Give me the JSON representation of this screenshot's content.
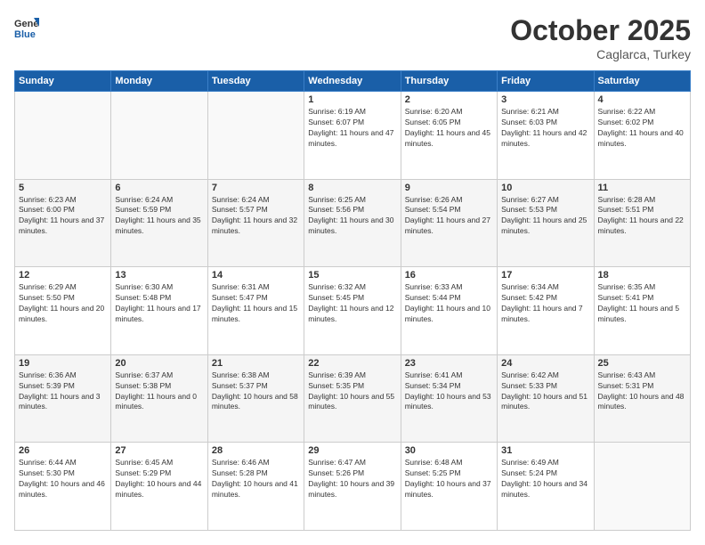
{
  "header": {
    "logo_line1": "General",
    "logo_line2": "Blue",
    "title": "October 2025",
    "subtitle": "Caglarca, Turkey"
  },
  "days_of_week": [
    "Sunday",
    "Monday",
    "Tuesday",
    "Wednesday",
    "Thursday",
    "Friday",
    "Saturday"
  ],
  "weeks": [
    [
      {
        "day": "",
        "info": ""
      },
      {
        "day": "",
        "info": ""
      },
      {
        "day": "",
        "info": ""
      },
      {
        "day": "1",
        "info": "Sunrise: 6:19 AM\nSunset: 6:07 PM\nDaylight: 11 hours and 47 minutes."
      },
      {
        "day": "2",
        "info": "Sunrise: 6:20 AM\nSunset: 6:05 PM\nDaylight: 11 hours and 45 minutes."
      },
      {
        "day": "3",
        "info": "Sunrise: 6:21 AM\nSunset: 6:03 PM\nDaylight: 11 hours and 42 minutes."
      },
      {
        "day": "4",
        "info": "Sunrise: 6:22 AM\nSunset: 6:02 PM\nDaylight: 11 hours and 40 minutes."
      }
    ],
    [
      {
        "day": "5",
        "info": "Sunrise: 6:23 AM\nSunset: 6:00 PM\nDaylight: 11 hours and 37 minutes."
      },
      {
        "day": "6",
        "info": "Sunrise: 6:24 AM\nSunset: 5:59 PM\nDaylight: 11 hours and 35 minutes."
      },
      {
        "day": "7",
        "info": "Sunrise: 6:24 AM\nSunset: 5:57 PM\nDaylight: 11 hours and 32 minutes."
      },
      {
        "day": "8",
        "info": "Sunrise: 6:25 AM\nSunset: 5:56 PM\nDaylight: 11 hours and 30 minutes."
      },
      {
        "day": "9",
        "info": "Sunrise: 6:26 AM\nSunset: 5:54 PM\nDaylight: 11 hours and 27 minutes."
      },
      {
        "day": "10",
        "info": "Sunrise: 6:27 AM\nSunset: 5:53 PM\nDaylight: 11 hours and 25 minutes."
      },
      {
        "day": "11",
        "info": "Sunrise: 6:28 AM\nSunset: 5:51 PM\nDaylight: 11 hours and 22 minutes."
      }
    ],
    [
      {
        "day": "12",
        "info": "Sunrise: 6:29 AM\nSunset: 5:50 PM\nDaylight: 11 hours and 20 minutes."
      },
      {
        "day": "13",
        "info": "Sunrise: 6:30 AM\nSunset: 5:48 PM\nDaylight: 11 hours and 17 minutes."
      },
      {
        "day": "14",
        "info": "Sunrise: 6:31 AM\nSunset: 5:47 PM\nDaylight: 11 hours and 15 minutes."
      },
      {
        "day": "15",
        "info": "Sunrise: 6:32 AM\nSunset: 5:45 PM\nDaylight: 11 hours and 12 minutes."
      },
      {
        "day": "16",
        "info": "Sunrise: 6:33 AM\nSunset: 5:44 PM\nDaylight: 11 hours and 10 minutes."
      },
      {
        "day": "17",
        "info": "Sunrise: 6:34 AM\nSunset: 5:42 PM\nDaylight: 11 hours and 7 minutes."
      },
      {
        "day": "18",
        "info": "Sunrise: 6:35 AM\nSunset: 5:41 PM\nDaylight: 11 hours and 5 minutes."
      }
    ],
    [
      {
        "day": "19",
        "info": "Sunrise: 6:36 AM\nSunset: 5:39 PM\nDaylight: 11 hours and 3 minutes."
      },
      {
        "day": "20",
        "info": "Sunrise: 6:37 AM\nSunset: 5:38 PM\nDaylight: 11 hours and 0 minutes."
      },
      {
        "day": "21",
        "info": "Sunrise: 6:38 AM\nSunset: 5:37 PM\nDaylight: 10 hours and 58 minutes."
      },
      {
        "day": "22",
        "info": "Sunrise: 6:39 AM\nSunset: 5:35 PM\nDaylight: 10 hours and 55 minutes."
      },
      {
        "day": "23",
        "info": "Sunrise: 6:41 AM\nSunset: 5:34 PM\nDaylight: 10 hours and 53 minutes."
      },
      {
        "day": "24",
        "info": "Sunrise: 6:42 AM\nSunset: 5:33 PM\nDaylight: 10 hours and 51 minutes."
      },
      {
        "day": "25",
        "info": "Sunrise: 6:43 AM\nSunset: 5:31 PM\nDaylight: 10 hours and 48 minutes."
      }
    ],
    [
      {
        "day": "26",
        "info": "Sunrise: 6:44 AM\nSunset: 5:30 PM\nDaylight: 10 hours and 46 minutes."
      },
      {
        "day": "27",
        "info": "Sunrise: 6:45 AM\nSunset: 5:29 PM\nDaylight: 10 hours and 44 minutes."
      },
      {
        "day": "28",
        "info": "Sunrise: 6:46 AM\nSunset: 5:28 PM\nDaylight: 10 hours and 41 minutes."
      },
      {
        "day": "29",
        "info": "Sunrise: 6:47 AM\nSunset: 5:26 PM\nDaylight: 10 hours and 39 minutes."
      },
      {
        "day": "30",
        "info": "Sunrise: 6:48 AM\nSunset: 5:25 PM\nDaylight: 10 hours and 37 minutes."
      },
      {
        "day": "31",
        "info": "Sunrise: 6:49 AM\nSunset: 5:24 PM\nDaylight: 10 hours and 34 minutes."
      },
      {
        "day": "",
        "info": ""
      }
    ]
  ]
}
